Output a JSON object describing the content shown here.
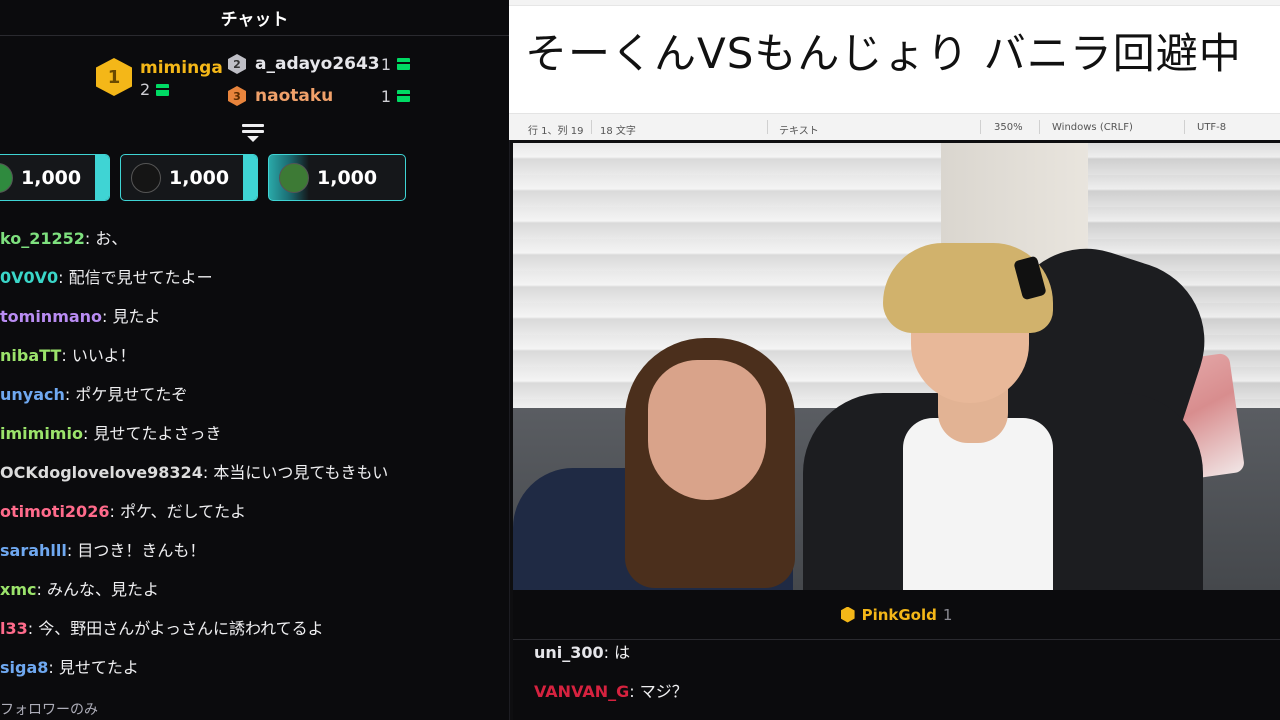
{
  "left_chat": {
    "header": "チャット",
    "leaderboard": {
      "first": {
        "rank": "1",
        "name": "miminga",
        "count": "2"
      },
      "second": {
        "rank": "2",
        "name": "a_adayo2643",
        "count": "1"
      },
      "third": {
        "rank": "3",
        "name": "naotaku",
        "count": "1"
      }
    },
    "bits": [
      {
        "amount": "1,000"
      },
      {
        "amount": "1,000"
      },
      {
        "amount": "1,000"
      }
    ],
    "messages": [
      {
        "user": "ko_21252",
        "sep": ": ",
        "text": "お、",
        "color": "#7ee07e"
      },
      {
        "user": "0V0V0",
        "sep": ": ",
        "text": "配信で見せてたよー",
        "color": "#3ad6c8"
      },
      {
        "user": "tominmano",
        "sep": ": ",
        "text": "見たよ",
        "color": "#b98cf2"
      },
      {
        "user": "nibaTT",
        "sep": ": ",
        "text": "いいよ！",
        "color": "#9be36b"
      },
      {
        "user": "unyach",
        "sep": ": ",
        "text": "ポケ見せてたぞ",
        "color": "#6fa8f0"
      },
      {
        "user": "imimimio",
        "sep": ": ",
        "text": "見せてたよさっき",
        "color": "#9be36b"
      },
      {
        "user": "OCKdoglovelove98324",
        "sep": ": ",
        "text": "本当にいつ見てもきもい",
        "color": "#dcdcdc"
      },
      {
        "user": "otimoti2026",
        "sep": ": ",
        "text": "ポケ、だしてたよ",
        "color": "#ff6b8b"
      },
      {
        "user": "sarahlll",
        "sep": ": ",
        "text": "目つき！きんも！",
        "color": "#6fa8f0"
      },
      {
        "user": "xmc",
        "sep": ": ",
        "text": "みんな、見たよ",
        "color": "#9be36b"
      },
      {
        "user": "l33",
        "sep": ": ",
        "text": "今、野田さんがよっさんに誘われてるよ",
        "color": "#ff6b8b"
      },
      {
        "user": "siga8",
        "sep": ": ",
        "text": "見せてたよ",
        "color": "#6fa8f0"
      }
    ],
    "footer": "フォロワーのみ"
  },
  "editor": {
    "text": "そーくんVSもんじょり バニラ回避中",
    "status": {
      "position": "行 1、列 19",
      "chars": "18 文字",
      "type": "テキスト",
      "zoom": "350%",
      "eol": "Windows (CRLF)",
      "encoding": "UTF-8"
    }
  },
  "right_chat": {
    "leaderboard": {
      "name": "PinkGold",
      "count": "1"
    },
    "messages": [
      {
        "user": "uni_300",
        "sep": ": ",
        "text": "は",
        "color": "#e6e6ea"
      },
      {
        "user": "VANVAN_G",
        "sep": ": ",
        "text": "マジ？",
        "color": "#d6223f"
      }
    ]
  }
}
